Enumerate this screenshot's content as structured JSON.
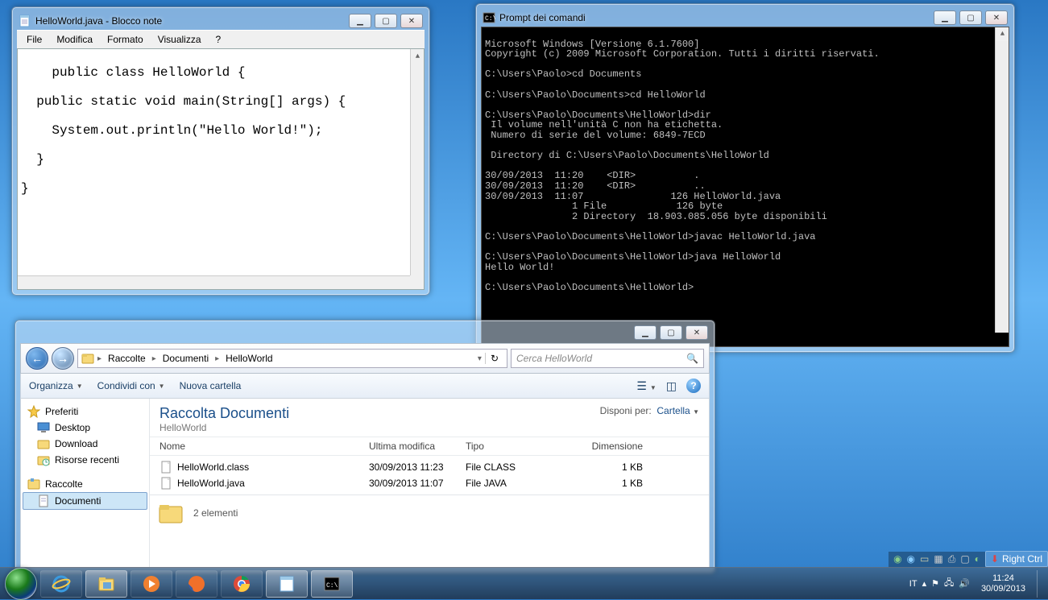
{
  "notepad": {
    "title": "HelloWorld.java - Blocco note",
    "menus": [
      "File",
      "Modifica",
      "Formato",
      "Visualizza",
      "?"
    ],
    "content": "public class HelloWorld {\n\n  public static void main(String[] args) {\n\n    System.out.println(\"Hello World!\");\n\n  }\n\n}"
  },
  "cmd": {
    "title": "Prompt dei comandi",
    "content": "Microsoft Windows [Versione 6.1.7600]\nCopyright (c) 2009 Microsoft Corporation. Tutti i diritti riservati.\n\nC:\\Users\\Paolo>cd Documents\n\nC:\\Users\\Paolo\\Documents>cd HelloWorld\n\nC:\\Users\\Paolo\\Documents\\HelloWorld>dir\n Il volume nell'unità C non ha etichetta.\n Numero di serie del volume: 6849-7ECD\n\n Directory di C:\\Users\\Paolo\\Documents\\HelloWorld\n\n30/09/2013  11:20    <DIR>          .\n30/09/2013  11:20    <DIR>          ..\n30/09/2013  11:07               126 HelloWorld.java\n               1 File            126 byte\n               2 Directory  18.903.085.056 byte disponibili\n\nC:\\Users\\Paolo\\Documents\\HelloWorld>javac HelloWorld.java\n\nC:\\Users\\Paolo\\Documents\\HelloWorld>java HelloWorld\nHello World!\n\nC:\\Users\\Paolo\\Documents\\HelloWorld>"
  },
  "explorer": {
    "breadcrumb": [
      "Raccolte",
      "Documenti",
      "HelloWorld"
    ],
    "search_placeholder": "Cerca HelloWorld",
    "toolbar": {
      "organize": "Organizza",
      "share": "Condividi con",
      "newfolder": "Nuova cartella"
    },
    "sidebar": {
      "fav_head": "Preferiti",
      "favs": [
        "Desktop",
        "Download",
        "Risorse recenti"
      ],
      "lib_head": "Raccolte",
      "libs": [
        "Documenti"
      ]
    },
    "lib_title": "Raccolta Documenti",
    "lib_sub": "HelloWorld",
    "arrange_label": "Disponi per:",
    "arrange_value": "Cartella",
    "columns": {
      "name": "Nome",
      "mod": "Ultima modifica",
      "type": "Tipo",
      "size": "Dimensione"
    },
    "files": [
      {
        "name": "HelloWorld.class",
        "mod": "30/09/2013 11:23",
        "type": "File CLASS",
        "size": "1 KB"
      },
      {
        "name": "HelloWorld.java",
        "mod": "30/09/2013 11:07",
        "type": "File JAVA",
        "size": "1 KB"
      }
    ],
    "status": "2 elementi"
  },
  "taskbar": {
    "lang": "IT",
    "time": "11:24",
    "date": "30/09/2013",
    "right_ctrl": "Right Ctrl"
  }
}
